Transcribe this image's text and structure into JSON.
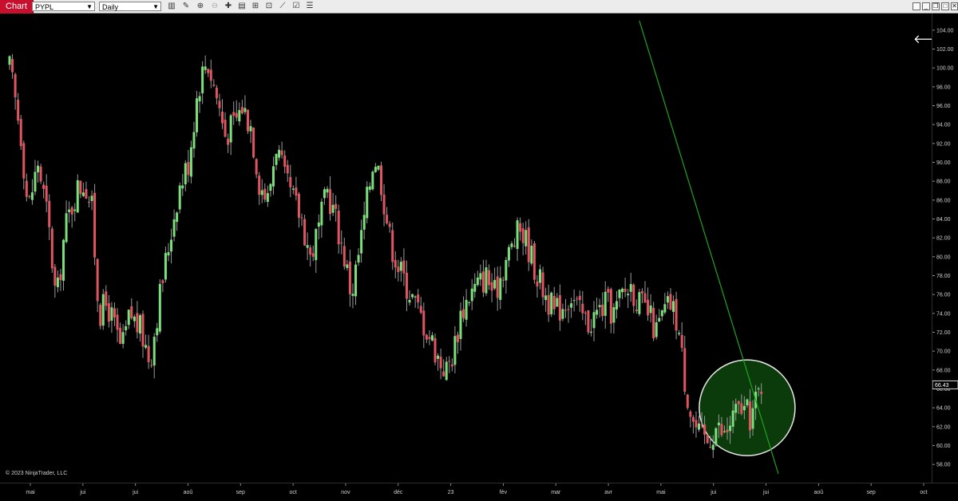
{
  "toolbar": {
    "tab_label": "Chart",
    "instrument": "PYPL",
    "interval": "Daily"
  },
  "copyright": "© 2023 NinjaTrader, LLC",
  "colors": {
    "background": "#000000",
    "up_candle": "#7be07b",
    "down_candle": "#e05560",
    "trendline": "#1fa51f",
    "highlight_fill": "#0c3d0c",
    "highlight_stroke": "#e8e8e8"
  },
  "chart_data": {
    "type": "candlestick",
    "instrument": "PYPL",
    "interval": "Daily",
    "ylim": [
      57,
      105
    ],
    "y_ticks": [
      "104.00",
      "102.00",
      "100.00",
      "98.00",
      "96.00",
      "94.00",
      "92.00",
      "90.00",
      "88.00",
      "86.00",
      "84.00",
      "82.00",
      "80.00",
      "78.00",
      "76.00",
      "74.00",
      "72.00",
      "70.00",
      "68.00",
      "66.00",
      "64.00",
      "62.00",
      "60.00",
      "58.00"
    ],
    "y_tick_values": [
      104,
      102,
      100,
      98,
      96,
      94,
      92,
      90,
      88,
      86,
      84,
      82,
      80,
      78,
      76,
      74,
      72,
      70,
      68,
      66,
      64,
      62,
      60,
      58
    ],
    "x_ticks": [
      "mai",
      "jui",
      "jui",
      "aoû",
      "sep",
      "oct",
      "nov",
      "déc",
      "23",
      "fév",
      "mar",
      "avr",
      "mai",
      "jui",
      "jui",
      "aoû",
      "sep",
      "oct"
    ],
    "last_price": "66.43",
    "last_price_value": 66.43,
    "price_path": [
      {
        "t": 0,
        "p": 100
      },
      {
        "t": 0.8,
        "p": 93
      },
      {
        "t": 1.3,
        "p": 85
      },
      {
        "t": 2,
        "p": 90
      },
      {
        "t": 2.7,
        "p": 84
      },
      {
        "t": 3.3,
        "p": 75
      },
      {
        "t": 3.9,
        "p": 83
      },
      {
        "t": 4.7,
        "p": 87
      },
      {
        "t": 5.3,
        "p": 88
      },
      {
        "t": 5.8,
        "p": 85
      },
      {
        "t": 6.3,
        "p": 74
      },
      {
        "t": 6.9,
        "p": 75
      },
      {
        "t": 7.4,
        "p": 72.5
      },
      {
        "t": 7.9,
        "p": 70
      },
      {
        "t": 8.5,
        "p": 74
      },
      {
        "t": 9.3,
        "p": 72
      },
      {
        "t": 9.9,
        "p": 69
      },
      {
        "t": 10.6,
        "p": 76
      },
      {
        "t": 11.3,
        "p": 82
      },
      {
        "t": 11.9,
        "p": 87
      },
      {
        "t": 12.6,
        "p": 90
      },
      {
        "t": 13.3,
        "p": 98
      },
      {
        "t": 13.9,
        "p": 101
      },
      {
        "t": 14.6,
        "p": 97
      },
      {
        "t": 15.2,
        "p": 93
      },
      {
        "t": 15.8,
        "p": 94
      },
      {
        "t": 16.4,
        "p": 96
      },
      {
        "t": 17.0,
        "p": 94
      },
      {
        "t": 17.6,
        "p": 88
      },
      {
        "t": 18.2,
        "p": 86
      },
      {
        "t": 18.8,
        "p": 92
      },
      {
        "t": 19.4,
        "p": 88
      },
      {
        "t": 20.0,
        "p": 86
      },
      {
        "t": 20.6,
        "p": 84
      },
      {
        "t": 21.2,
        "p": 80
      },
      {
        "t": 21.8,
        "p": 83
      },
      {
        "t": 22.4,
        "p": 87
      },
      {
        "t": 23.0,
        "p": 84
      },
      {
        "t": 23.6,
        "p": 80
      },
      {
        "t": 24.1,
        "p": 76
      },
      {
        "t": 24.7,
        "p": 81
      },
      {
        "t": 25.2,
        "p": 86
      },
      {
        "t": 25.7,
        "p": 91
      },
      {
        "t": 26.2,
        "p": 88
      },
      {
        "t": 26.8,
        "p": 82
      },
      {
        "t": 27.4,
        "p": 79
      },
      {
        "t": 28.0,
        "p": 77
      },
      {
        "t": 28.6,
        "p": 75
      },
      {
        "t": 29.2,
        "p": 73
      },
      {
        "t": 29.8,
        "p": 71
      },
      {
        "t": 30.3,
        "p": 69
      },
      {
        "t": 30.8,
        "p": 68
      },
      {
        "t": 31.3,
        "p": 70
      },
      {
        "t": 31.8,
        "p": 74
      },
      {
        "t": 32.4,
        "p": 76
      },
      {
        "t": 33.0,
        "p": 77
      },
      {
        "t": 33.6,
        "p": 78
      },
      {
        "t": 34.2,
        "p": 76
      },
      {
        "t": 34.8,
        "p": 79
      },
      {
        "t": 35.4,
        "p": 81
      },
      {
        "t": 36.0,
        "p": 83
      },
      {
        "t": 36.6,
        "p": 81
      },
      {
        "t": 37.2,
        "p": 78
      },
      {
        "t": 37.8,
        "p": 76
      },
      {
        "t": 38.4,
        "p": 74
      },
      {
        "t": 39.0,
        "p": 75
      },
      {
        "t": 39.6,
        "p": 76
      },
      {
        "t": 40.2,
        "p": 74
      },
      {
        "t": 40.8,
        "p": 73
      },
      {
        "t": 41.4,
        "p": 74
      },
      {
        "t": 42.0,
        "p": 75
      },
      {
        "t": 42.6,
        "p": 74
      },
      {
        "t": 43.2,
        "p": 76
      },
      {
        "t": 43.8,
        "p": 77
      },
      {
        "t": 44.4,
        "p": 75
      },
      {
        "t": 45.0,
        "p": 74
      },
      {
        "t": 45.6,
        "p": 72
      },
      {
        "t": 46.1,
        "p": 74
      },
      {
        "t": 46.6,
        "p": 75
      },
      {
        "t": 47.1,
        "p": 73
      },
      {
        "t": 47.6,
        "p": 67
      },
      {
        "t": 48.1,
        "p": 63
      },
      {
        "t": 48.6,
        "p": 61
      },
      {
        "t": 49.2,
        "p": 60.5
      },
      {
        "t": 49.8,
        "p": 62
      },
      {
        "t": 50.4,
        "p": 61
      },
      {
        "t": 51.0,
        "p": 63
      },
      {
        "t": 51.6,
        "p": 64
      },
      {
        "t": 52.2,
        "p": 63
      },
      {
        "t": 52.6,
        "p": 64.5
      },
      {
        "t": 53.0,
        "p": 66.4
      }
    ],
    "x_domain": [
      0,
      64.5
    ],
    "trendline": [
      {
        "t": 44.4,
        "p": 105
      },
      {
        "t": 54.2,
        "p": 57
      }
    ],
    "highlight_circle": {
      "t_center": 52.0,
      "p_center": 64.0,
      "note": "highlighted area"
    }
  }
}
